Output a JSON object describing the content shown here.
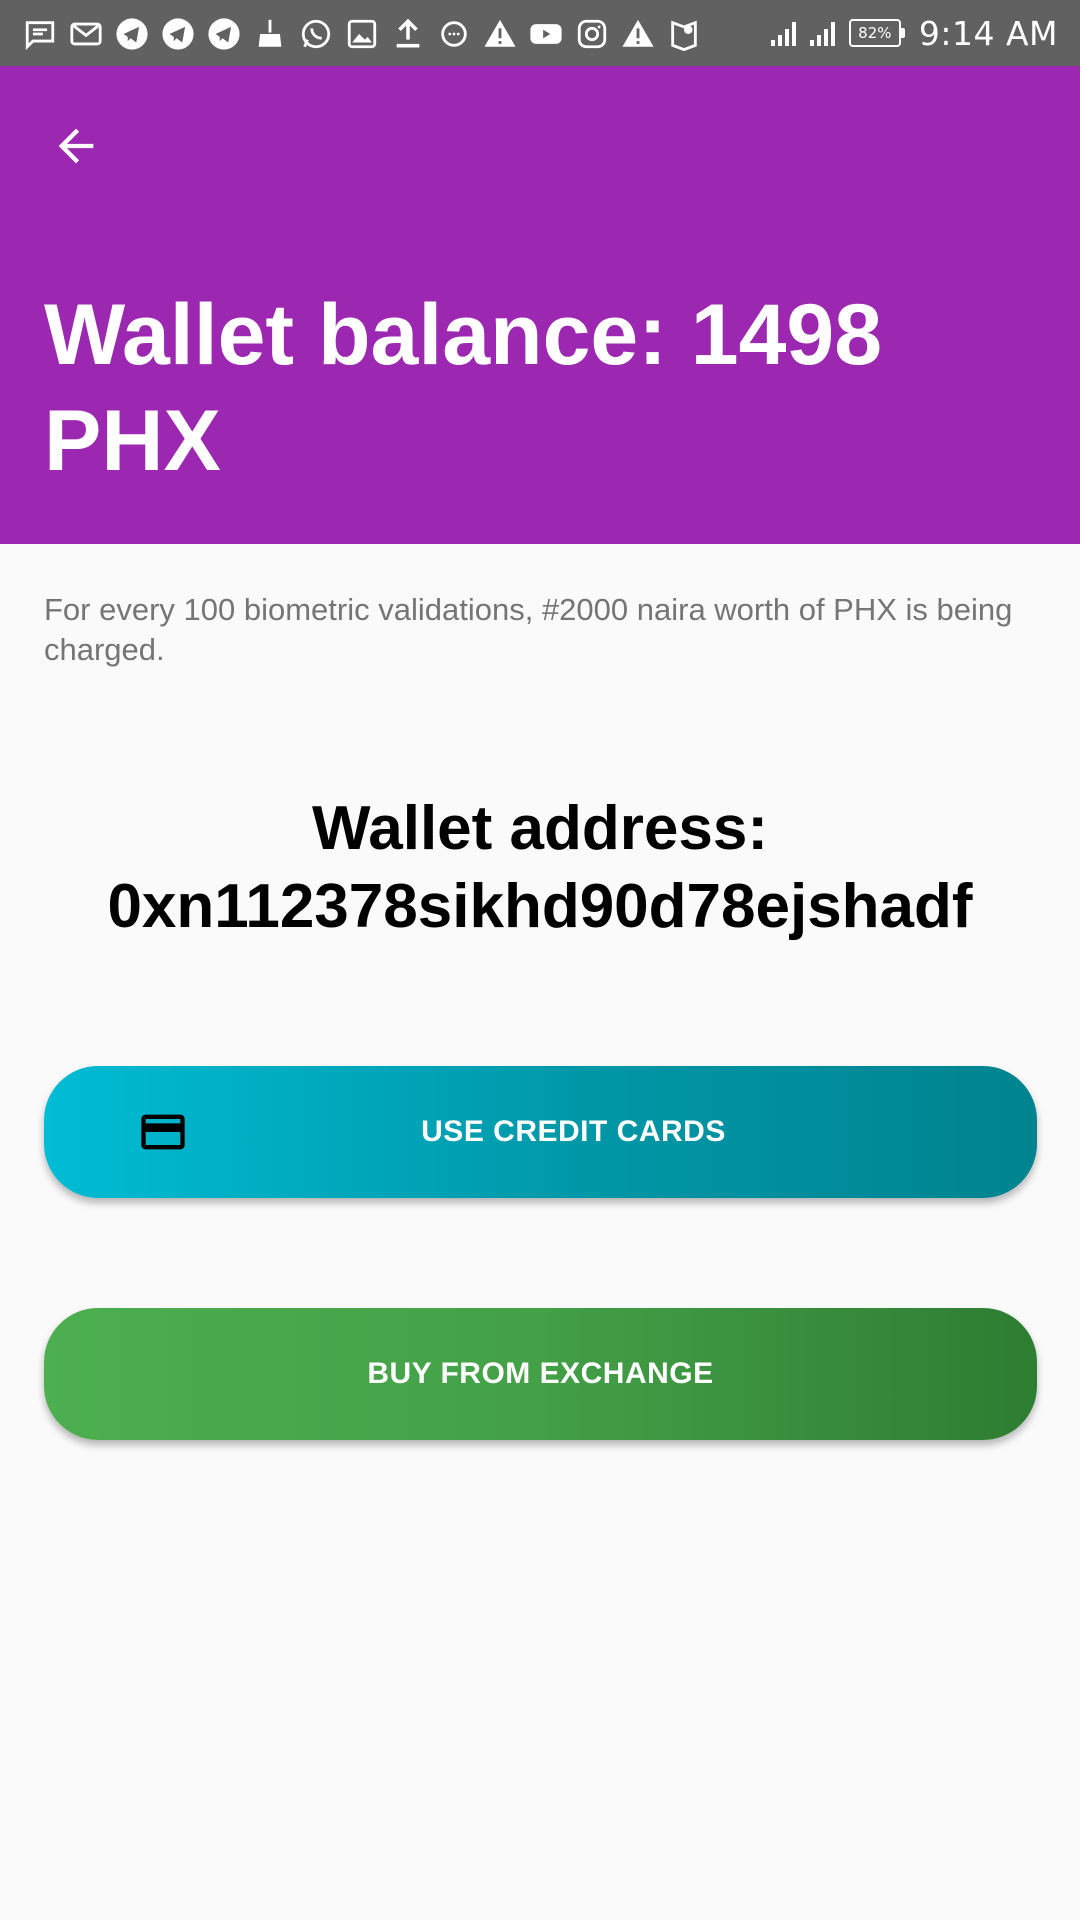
{
  "status_bar": {
    "left_icons": [
      "message-icon",
      "gmail-icon",
      "telegram-icon",
      "telegram-icon",
      "telegram-icon",
      "broom-icon",
      "whatsapp-icon",
      "image-icon",
      "upload-icon",
      "chat-bubble-icon",
      "warning-icon",
      "youtube-icon",
      "instagram-icon",
      "warning-icon",
      "maps-icon"
    ],
    "battery": "82%",
    "time": "9:14 AM"
  },
  "header": {
    "back_icon": "arrow-back-icon",
    "title": "Wallet balance: 1498 PHX",
    "background_color": "#9c27b0"
  },
  "body": {
    "note": "For every 100 biometric validations, #2000 naira worth of PHX is being charged.",
    "wallet_address_label": "Wallet address: 0xn112378sikhd90d78ejshadf"
  },
  "buttons": {
    "credit_cards": {
      "label": "USE CREDIT CARDS",
      "icon": "credit-card-icon",
      "color": "#00acc1"
    },
    "exchange": {
      "label": "BUY FROM EXCHANGE",
      "color": "#43a047"
    }
  }
}
